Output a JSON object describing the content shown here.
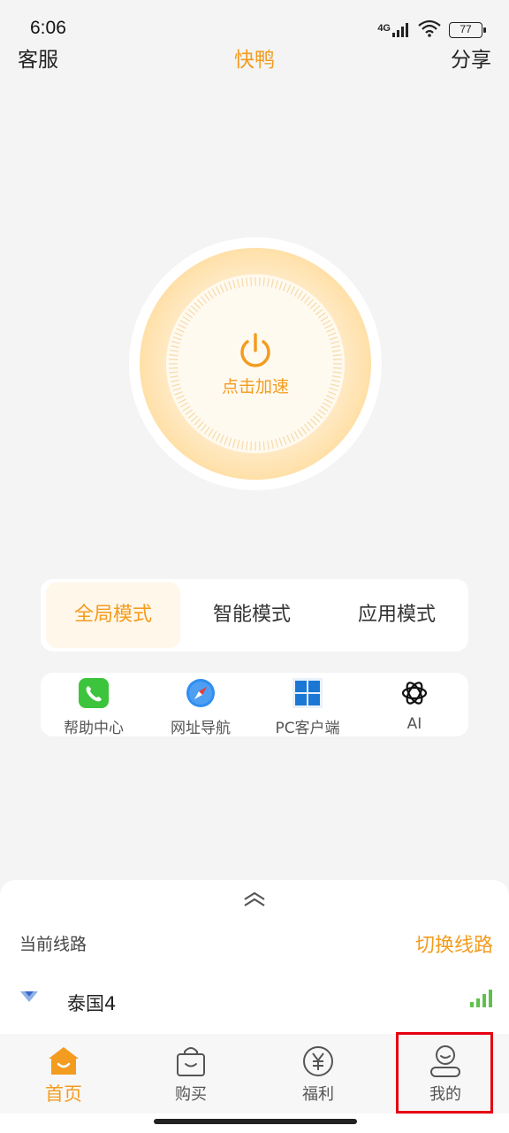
{
  "status_bar": {
    "time": "6:06",
    "network": "4G",
    "battery": "77"
  },
  "header": {
    "left": "客服",
    "title": "快鸭",
    "right": "分享"
  },
  "power": {
    "label": "点击加速",
    "icon": "power-icon"
  },
  "modes": {
    "items": [
      {
        "label": "全局模式",
        "active": true
      },
      {
        "label": "智能模式",
        "active": false
      },
      {
        "label": "应用模式",
        "active": false
      }
    ]
  },
  "quick_links": [
    {
      "label": "帮助中心",
      "icon": "phone-icon"
    },
    {
      "label": "网址导航",
      "icon": "compass-icon"
    },
    {
      "label": "PC客户端",
      "icon": "windows-icon"
    },
    {
      "label": "AI",
      "icon": "openai-icon"
    }
  ],
  "line_panel": {
    "title": "当前线路",
    "switch_label": "切换线路",
    "server_name": "泰国4"
  },
  "tabbar": {
    "items": [
      {
        "label": "首页",
        "icon": "home-icon",
        "active": true
      },
      {
        "label": "购买",
        "icon": "shopping-bag-icon",
        "active": false
      },
      {
        "label": "福利",
        "icon": "yen-coin-icon",
        "active": false
      },
      {
        "label": "我的",
        "icon": "user-icon",
        "active": false
      }
    ]
  },
  "colors": {
    "accent": "#f39c1f",
    "highlight_box": "#e60012",
    "signal": "#5ec24a"
  }
}
